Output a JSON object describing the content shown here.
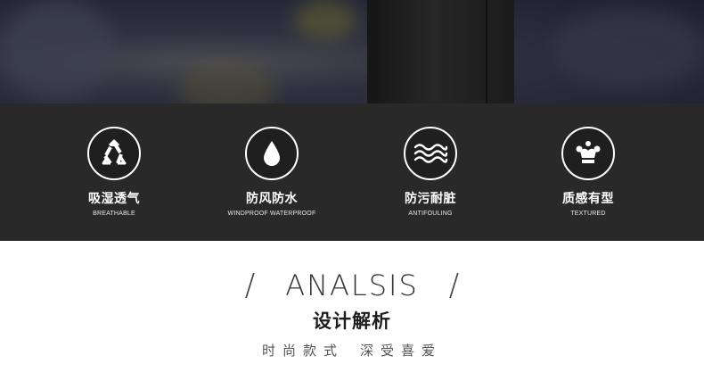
{
  "features": [
    {
      "icon": "recycle-icon",
      "title_cn": "吸湿透气",
      "title_en": "BREATHABLE"
    },
    {
      "icon": "water-drop-icon",
      "title_cn": "防风防水",
      "title_en": "WINDPROOF WATERPROOF"
    },
    {
      "icon": "waves-icon",
      "title_cn": "防污耐脏",
      "title_en": "ANTIFOULING"
    },
    {
      "icon": "crown-icon",
      "title_cn": "质感有型",
      "title_en": "TEXTURED"
    }
  ],
  "analysis": {
    "slash_left": "/",
    "title_en": "ANALSIS",
    "slash_right": "/",
    "title_cn": "设计解析",
    "subtitle_a": "时尚款式",
    "subtitle_b": "深受喜爱"
  },
  "colors": {
    "band": "#292929",
    "icon_stroke": "#ffffff",
    "text_dark": "#1d1d1d"
  }
}
